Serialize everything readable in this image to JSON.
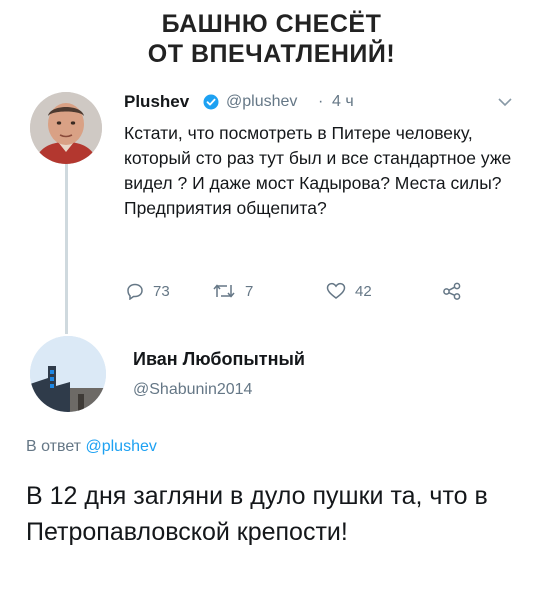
{
  "headline": {
    "line1": "БАШНЮ СНЕСЁТ",
    "line2": "ОТ ВПЕЧАТЛЕНИЙ!"
  },
  "tweet1": {
    "name": "Plushev",
    "handle": "@plushev",
    "separator": "·",
    "time": "4 ч",
    "text": "Кстати, что посмотреть в Питере человеку, который сто раз тут был и все стандартное уже видел ? И даже мост Кадырова? Места силы? Предприятия  общепита?",
    "replies": "73",
    "retweets": "7",
    "likes": "42",
    "icons": [
      "verified-badge-icon",
      "chevron-down-icon",
      "reply-icon",
      "retweet-icon",
      "heart-icon",
      "share-icon"
    ]
  },
  "tweet2": {
    "name": "Иван Любопытный",
    "handle": "@Shabunin2014",
    "reply_prefix": "В ответ",
    "reply_handle": "@plushev",
    "text": "В 12 дня загляни в дуло пушки та, что в Петропавловской крепости!"
  },
  "colors": {
    "accent": "#1da1f2",
    "muted": "#657786",
    "text": "#14171a",
    "thread_line": "#cfd9de"
  }
}
